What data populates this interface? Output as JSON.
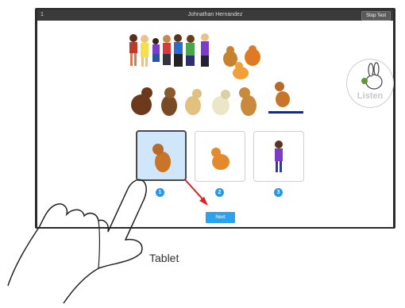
{
  "topbar": {
    "page_number": "1",
    "student_name": "Johnathan Hernandez",
    "stop_test_label": "Stop Test"
  },
  "listen": {
    "label": "Listen"
  },
  "options": [
    {
      "number": "1",
      "picture": "dog-icon",
      "selected": true
    },
    {
      "number": "2",
      "picture": "cat-icon",
      "selected": false
    },
    {
      "number": "3",
      "picture": "person-icon",
      "selected": false
    }
  ],
  "next_label": "Next",
  "caption": "Tablet",
  "colors": {
    "accent": "#2aa3ee",
    "selection": "#cfe6fb",
    "underline": "#1a2a7a",
    "arrow": "#e02020"
  }
}
